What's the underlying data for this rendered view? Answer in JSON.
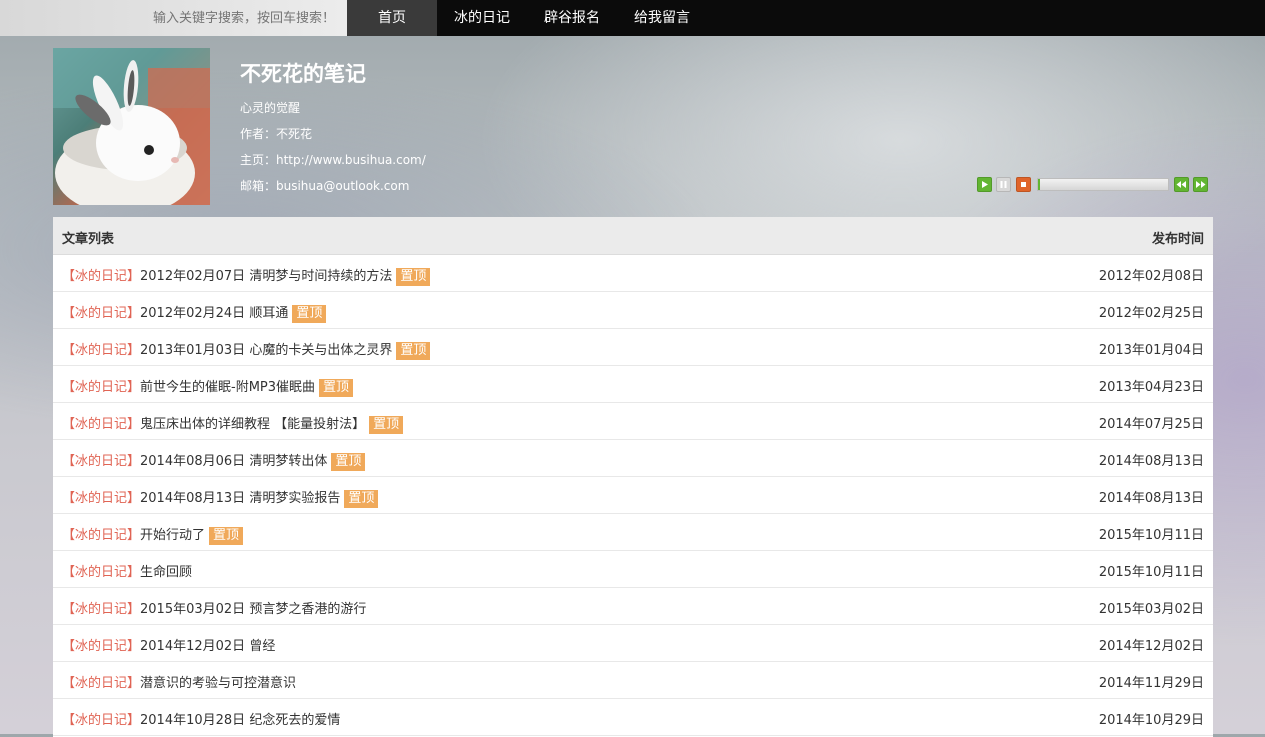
{
  "topbar": {
    "search_placeholder": "输入关键字搜索，按回车搜索！",
    "nav": [
      "首页",
      "冰的日记",
      "辟谷报名",
      "给我留言"
    ]
  },
  "header": {
    "title": "不死花的笔记",
    "subtitle": "心灵的觉醒",
    "author": "作者：不死花",
    "homepage": "主页：http://www.busihua.com/",
    "email": "邮箱：busihua@outlook.com"
  },
  "player": {
    "progress": 0.0
  },
  "list": {
    "col_title": "文章列表",
    "col_date": "发布时间",
    "sticky_label": "置顶",
    "rows": [
      {
        "cat": "【冰的日记】",
        "title": "2012年02月07日 清明梦与时间持续的方法",
        "sticky": true,
        "date": "2012年02月08日"
      },
      {
        "cat": "【冰的日记】",
        "title": "2012年02月24日 顺耳通",
        "sticky": true,
        "date": "2012年02月25日"
      },
      {
        "cat": "【冰的日记】",
        "title": "2013年01月03日 心魔的卡关与出体之灵界",
        "sticky": true,
        "date": "2013年01月04日"
      },
      {
        "cat": "【冰的日记】",
        "title": "前世今生的催眠-附MP3催眠曲",
        "sticky": true,
        "date": "2013年04月23日"
      },
      {
        "cat": "【冰的日记】",
        "title": "鬼压床出体的详细教程 【能量投射法】",
        "sticky": true,
        "date": "2014年07月25日"
      },
      {
        "cat": "【冰的日记】",
        "title": "2014年08月06日 清明梦转出体",
        "sticky": true,
        "date": "2014年08月13日"
      },
      {
        "cat": "【冰的日记】",
        "title": "2014年08月13日 清明梦实验报告",
        "sticky": true,
        "date": "2014年08月13日"
      },
      {
        "cat": "【冰的日记】",
        "title": "开始行动了",
        "sticky": true,
        "date": "2015年10月11日"
      },
      {
        "cat": "【冰的日记】",
        "title": "生命回顾",
        "sticky": false,
        "date": "2015年10月11日"
      },
      {
        "cat": "【冰的日记】",
        "title": "2015年03月02日 预言梦之香港的游行",
        "sticky": false,
        "date": "2015年03月02日"
      },
      {
        "cat": "【冰的日记】",
        "title": "2014年12月02日 曾经",
        "sticky": false,
        "date": "2014年12月02日"
      },
      {
        "cat": "【冰的日记】",
        "title": "潜意识的考验与可控潜意识",
        "sticky": false,
        "date": "2014年11月29日"
      },
      {
        "cat": "【冰的日记】",
        "title": "2014年10月28日 纪念死去的爱情",
        "sticky": false,
        "date": "2014年10月29日"
      }
    ]
  },
  "colors": {
    "nav_bg": "#0b0b0b",
    "category": "#e06454",
    "sticky_badge": "#f0a95a",
    "player_play": "#62b532",
    "player_stop": "#e0642a"
  }
}
